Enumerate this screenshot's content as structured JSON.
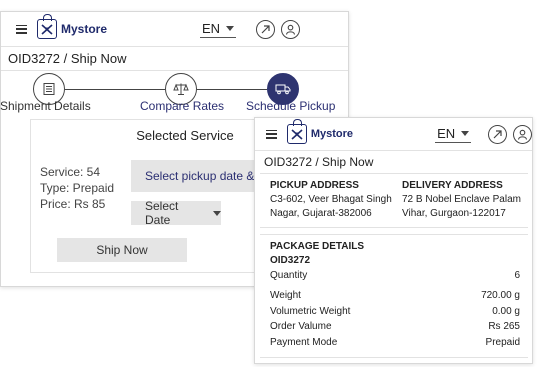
{
  "header": {
    "brand": "Mystore",
    "lang": "EN"
  },
  "back_screen": {
    "breadcrumb": "OID3272 / Ship Now",
    "steps": [
      {
        "label": "Shipment Details"
      },
      {
        "label": "Compare Rates"
      },
      {
        "label": "Schedule Pickup"
      }
    ],
    "selected_service": {
      "heading": "Selected Service",
      "service": "Service: 54",
      "type": "Type: Prepaid",
      "price": "Price: Rs 85",
      "pickup_button": "Select pickup date & time",
      "date_select": "Select Date",
      "ship_button": "Ship Now"
    }
  },
  "front_screen": {
    "breadcrumb": "OID3272 / Ship Now",
    "pickup": {
      "title": "PICKUP ADDRESS",
      "line1": "C3-602, Veer Bhagat Singh",
      "line2": "Nagar, Gujarat-382006"
    },
    "delivery": {
      "title": "DELIVERY ADDRESS",
      "line1": "72 B Nobel Enclave Palam",
      "line2": "Vihar, Gurgaon-122017"
    },
    "package": {
      "title": "PACKAGE DETAILS",
      "order_id": "OID3272",
      "rows": [
        {
          "label": "Quantity",
          "value": "6"
        },
        {
          "label": "Weight",
          "value": "720.00 g"
        },
        {
          "label": "Volumetric Weight",
          "value": "0.00 g"
        },
        {
          "label": "Order Valume",
          "value": "Rs 265"
        },
        {
          "label": "Payment Mode",
          "value": "Prepaid"
        }
      ]
    }
  },
  "colors": {
    "brand": "#1f2a6b",
    "active_step": "#2e3470",
    "button_gray": "#e5e5e5"
  }
}
